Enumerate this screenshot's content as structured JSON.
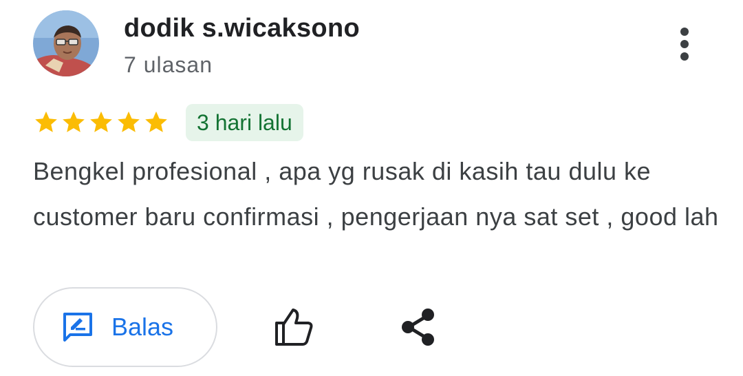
{
  "reviewer": {
    "name": "dodik s.wicaksono",
    "review_count": "7 ulasan"
  },
  "rating": {
    "stars": 5,
    "max": 5,
    "date": "3 hari lalu"
  },
  "review": {
    "text": "Bengkel profesional , apa yg rusak di kasih tau dulu ke customer baru confirmasi , pengerjaan nya sat set , good lah"
  },
  "actions": {
    "reply_label": "Balas"
  },
  "icons": {
    "more": "more-vert-icon",
    "reply": "rate-review-icon",
    "like": "thumb-up-icon",
    "share": "share-icon"
  },
  "colors": {
    "star": "#fbbc04",
    "accent": "#1a73e8",
    "badge_bg": "#e6f4ea",
    "badge_text": "#137333"
  }
}
